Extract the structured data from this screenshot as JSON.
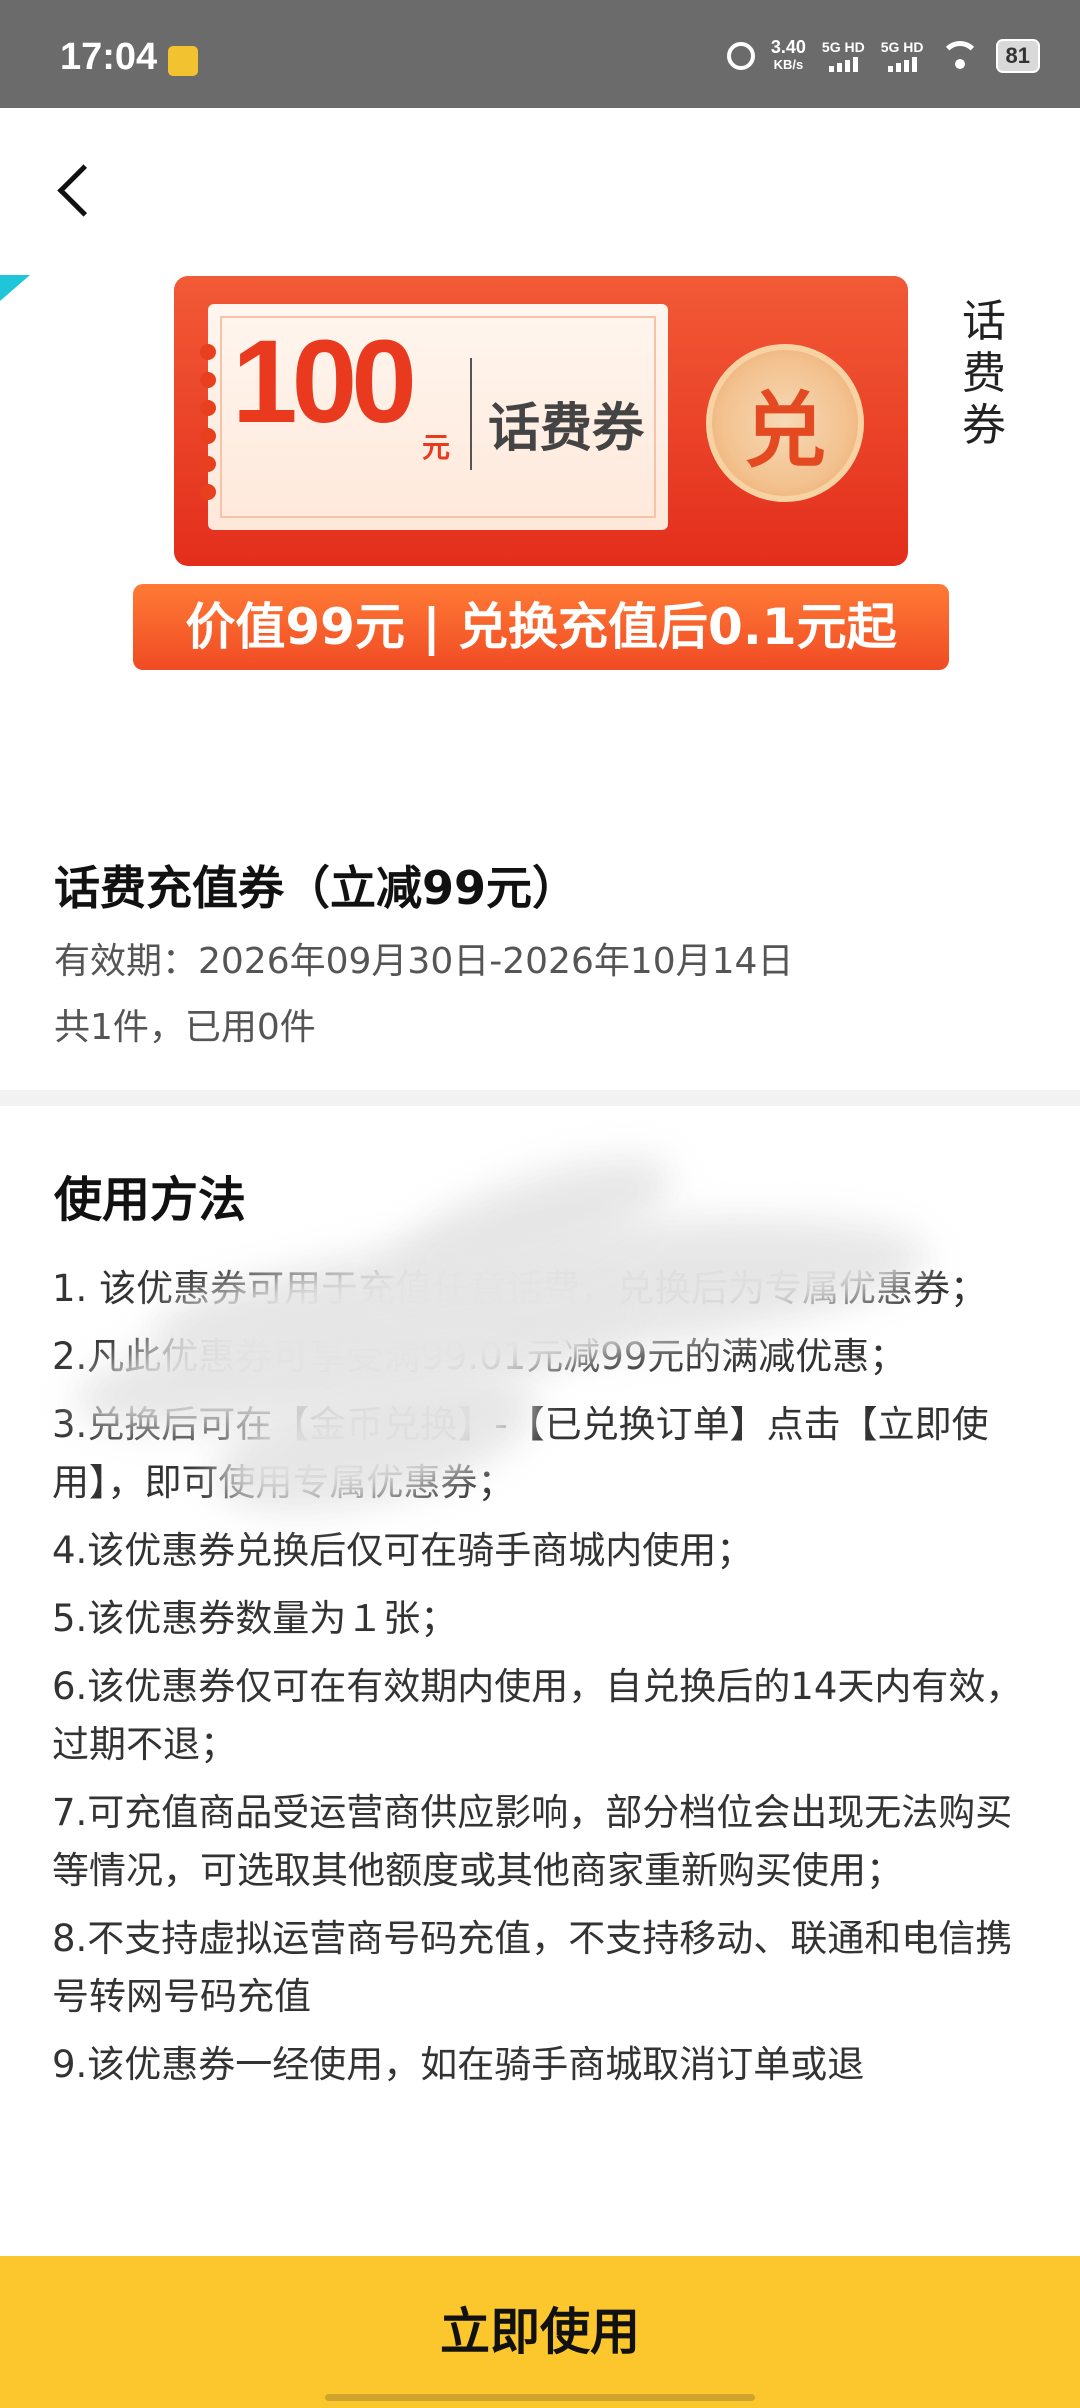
{
  "status_bar": {
    "time": "17:04",
    "net_speed": "3.40",
    "net_speed_unit": "KB/s",
    "sim1": "5G HD",
    "sim2": "5G HD",
    "battery": "81",
    "icons": [
      "app-notification-icon",
      "alarm-icon",
      "signal-icon",
      "signal-icon",
      "wifi-icon",
      "battery-icon"
    ]
  },
  "header": {
    "back_icon": "chevron-left-icon"
  },
  "coupon_image": {
    "amount": "100",
    "amount_unit": "元",
    "name": "话费券",
    "badge": "兑",
    "side_label": "话费券",
    "banner": "价值99元 | 兑换充值后0.1元起"
  },
  "coupon_info": {
    "title": "话费充值券（立减99元）",
    "validity": "有效期：2026年09月30日-2026年10月14日",
    "usage": "共1件，已用0件"
  },
  "instructions": {
    "title": "使用方法",
    "items": [
      "1. 该优惠券可用于充值任意话费，兑换后为专属优惠券；",
      "2.凡此优惠券可享受满99.01元减99元的满减优惠；",
      "3.兑换后可在【金币兑换】-【已兑换订单】点击【立即使用】，即可使用专属优惠券；",
      "4.该优惠券兑换后仅可在骑手商城内使用；",
      "5.该优惠券数量为１张；",
      "6.该优惠券仅可在有效期内使用，自兑换后的14天内有效，过期不退；",
      "7.可充值商品受运营商供应影响，部分档位会出现无法购买等情况，可选取其他额度或其他商家重新购买使用；",
      "8.不支持虚拟运营商号码充值，不支持移动、联通和电信携号转网号码充值",
      "9.该优惠券一经使用，如在骑手商城取消订单或退"
    ]
  },
  "cta": {
    "label": "立即使用"
  },
  "colors": {
    "accent": "#fcc72d",
    "coupon_red": "#e93a1f",
    "banner_orange": "#f04b24"
  }
}
